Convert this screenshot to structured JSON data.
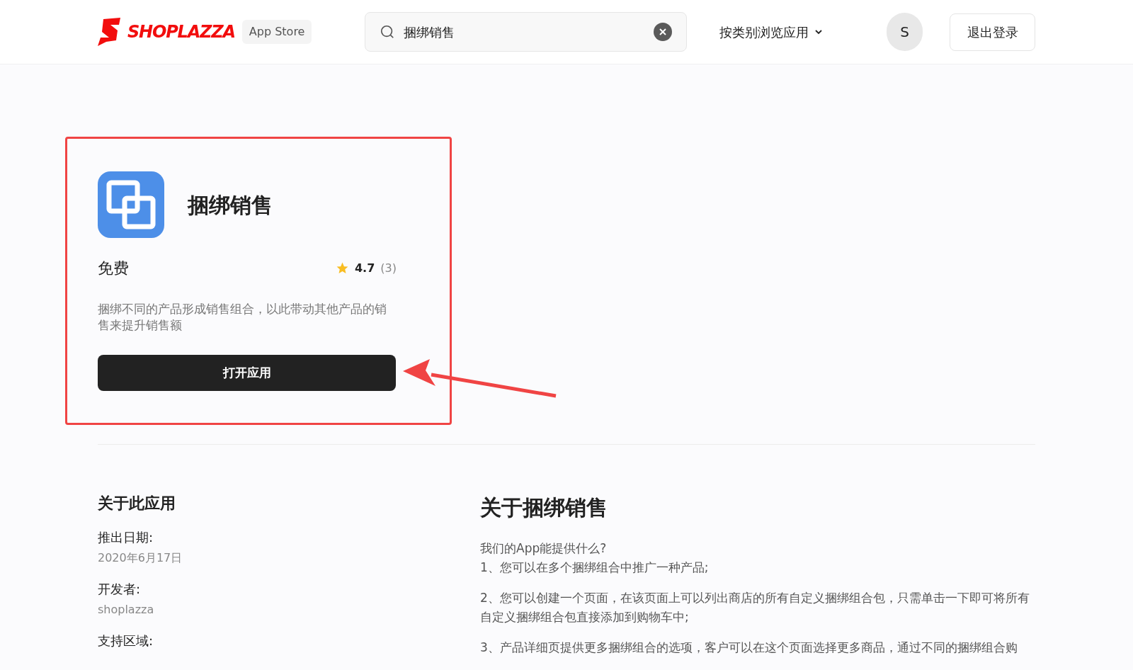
{
  "header": {
    "logo": "SHOPLAZZA",
    "badge": "App Store",
    "search": {
      "value": "捆绑销售"
    },
    "category_menu": "按类别浏览应用",
    "avatar": "S",
    "logout": "退出登录"
  },
  "app_card": {
    "highlighted": true,
    "name": "捆绑销售",
    "price": "免费",
    "rating": "4.7",
    "review_count": "(3)",
    "description": "捆绑不同的产品形成销售组合，以此带动其他产品的销售来提升销售额",
    "open_button": "打开应用"
  },
  "about_app": {
    "heading": "关于此应用",
    "fields": [
      {
        "label": "推出日期:",
        "value": "2020年6月17日"
      },
      {
        "label": "开发者:",
        "value": "shoplazza"
      },
      {
        "label": "支持区域:"
      }
    ]
  },
  "about_bundle": {
    "heading": "关于捆绑销售",
    "paragraphs": [
      [
        "我们的App能提供什么?",
        "1、您可以在多个捆绑组合中推广一种产品;"
      ],
      [
        "2、您可以创建一个页面，在该页面上可以列出商店的所有自定义捆绑组合包，只需单击一下即可将所有自定义捆绑组合包直接添加到购物车中;"
      ],
      [
        "3、产品详细页提供更多捆绑组合的选项，客户可以在这个页面选择更多商品，通过不同的捆绑组合购"
      ]
    ]
  }
}
